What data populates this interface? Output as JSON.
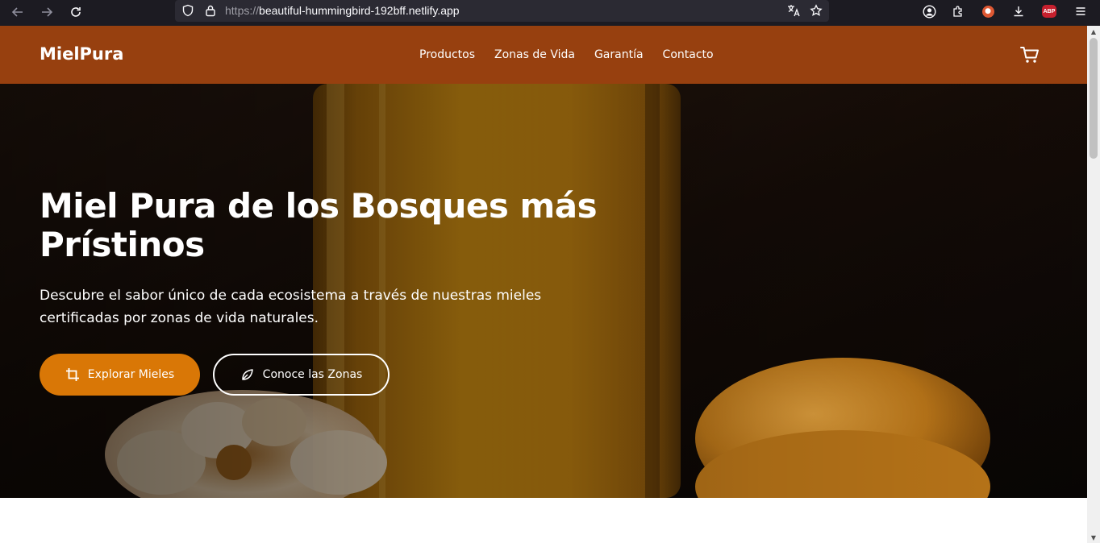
{
  "browser": {
    "url_protocol": "https://",
    "url_host": "beautiful-hummingbird-192bff.netlify.app",
    "icons": [
      "back-arrow-icon",
      "forward-arrow-icon",
      "reload-icon",
      "shield-icon",
      "lock-icon",
      "translate-icon",
      "star-icon",
      "account-icon",
      "extensions-icon",
      "duckduckgo-icon",
      "downloads-icon",
      "adblock-icon",
      "menu-icon"
    ],
    "abp_label": "ABP"
  },
  "header": {
    "logo": "MielPura",
    "nav": [
      "Productos",
      "Zonas de Vida",
      "Garantía",
      "Contacto"
    ],
    "cart_icon": "cart-icon"
  },
  "hero": {
    "title": "Miel Pura de los Bosques más Prístinos",
    "subtitle": "Descubre el sabor único de cada ecosistema a través de nuestras mieles certificadas por zonas de vida naturales.",
    "primary_button": "Explorar Mieles",
    "secondary_button": "Conoce las Zonas"
  },
  "colors": {
    "header_bg": "#97400f",
    "primary_button": "#d97706",
    "honey": "#c98a12"
  }
}
